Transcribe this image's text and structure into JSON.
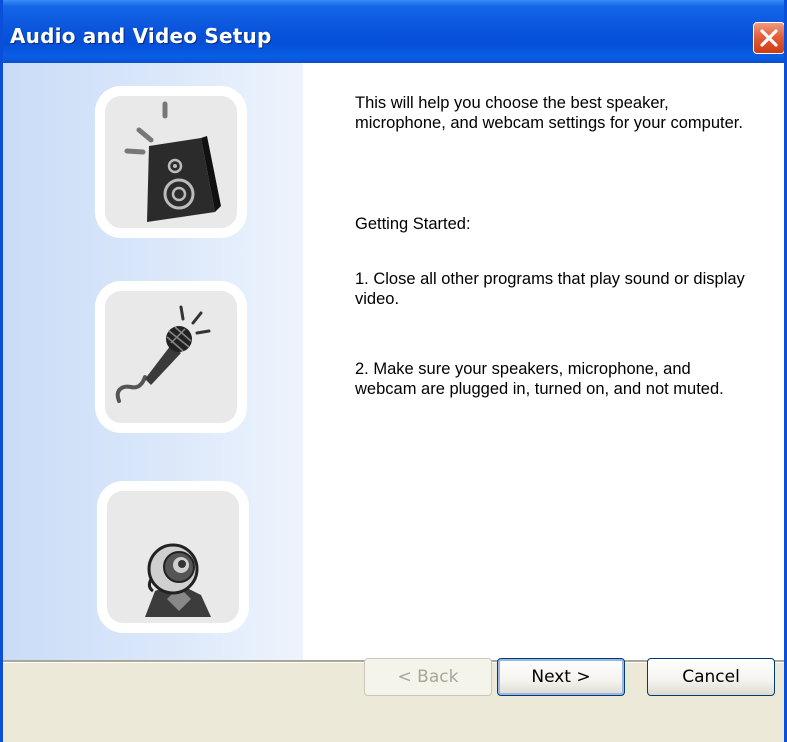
{
  "window": {
    "title": "Audio and Video Setup"
  },
  "left_panel": {
    "icons": [
      "speaker-icon",
      "microphone-icon",
      "webcam-icon"
    ]
  },
  "content": {
    "intro": "This will help you choose the best speaker, microphone, and webcam settings for your computer.",
    "heading": "Getting Started:",
    "step1": "1. Close all other programs that play sound or display video.",
    "step2": "2. Make sure your speakers, microphone, and webcam are plugged in, turned on, and not muted."
  },
  "buttons": {
    "back": "< Back",
    "next": "Next >",
    "cancel": "Cancel"
  },
  "colors": {
    "titlebar": "#0a55dc",
    "close_button": "#e35f3b",
    "left_panel": "#dbe8fa",
    "footer": "#ece9d8"
  }
}
